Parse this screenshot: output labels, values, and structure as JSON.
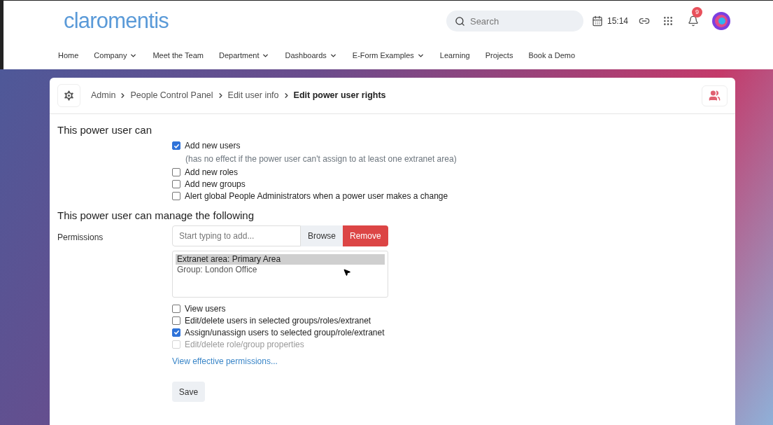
{
  "header": {
    "logo": "claromentis",
    "search": {
      "placeholder": "Search"
    },
    "time": "15:14",
    "notifications": "9"
  },
  "nav": [
    {
      "label": "Home",
      "dropdown": false
    },
    {
      "label": "Company",
      "dropdown": true
    },
    {
      "label": "Meet the Team",
      "dropdown": false
    },
    {
      "label": "Department",
      "dropdown": true
    },
    {
      "label": "Dashboards",
      "dropdown": true
    },
    {
      "label": "E-Form Examples",
      "dropdown": true
    },
    {
      "label": "Learning",
      "dropdown": false
    },
    {
      "label": "Projects",
      "dropdown": false
    },
    {
      "label": "Book a Demo",
      "dropdown": false
    }
  ],
  "breadcrumb": [
    {
      "label": "Admin",
      "current": false
    },
    {
      "label": "People Control Panel",
      "current": false
    },
    {
      "label": "Edit user info",
      "current": false
    },
    {
      "label": "Edit power user rights",
      "current": true
    }
  ],
  "section1": {
    "title": "This power user can",
    "options": [
      {
        "kind": "checkbox",
        "label": "Add new users",
        "checked": true,
        "disabled": false
      },
      {
        "kind": "note",
        "label": "(has no effect if the power user can't assign to at least one extranet area)"
      },
      {
        "kind": "checkbox",
        "label": "Add new roles",
        "checked": false,
        "disabled": false
      },
      {
        "kind": "checkbox",
        "label": "Add new groups",
        "checked": false,
        "disabled": false
      },
      {
        "kind": "checkbox",
        "label": "Alert global People Administrators when a power user makes a change",
        "checked": false,
        "disabled": false
      }
    ]
  },
  "section2": {
    "title": "This power user can manage the following",
    "label": "Permissions",
    "field": {
      "placeholder": "Start typing to add..."
    },
    "browse": "Browse",
    "remove": "Remove",
    "items": [
      {
        "label": "Extranet area: Primary Area",
        "selected": true
      },
      {
        "label": "Group: London Office",
        "selected": false
      }
    ],
    "options": [
      {
        "kind": "checkbox",
        "label": "View users",
        "checked": false,
        "disabled": false
      },
      {
        "kind": "checkbox",
        "label": "Edit/delete users in selected groups/roles/extranet",
        "checked": false,
        "disabled": false
      },
      {
        "kind": "checkbox",
        "label": "Assign/unassign users to selected group/role/extranet",
        "checked": true,
        "disabled": false
      },
      {
        "kind": "checkbox",
        "label": "Edit/delete role/group properties",
        "checked": false,
        "disabled": true
      }
    ],
    "link": "View effective permissions...",
    "save": "Save"
  }
}
